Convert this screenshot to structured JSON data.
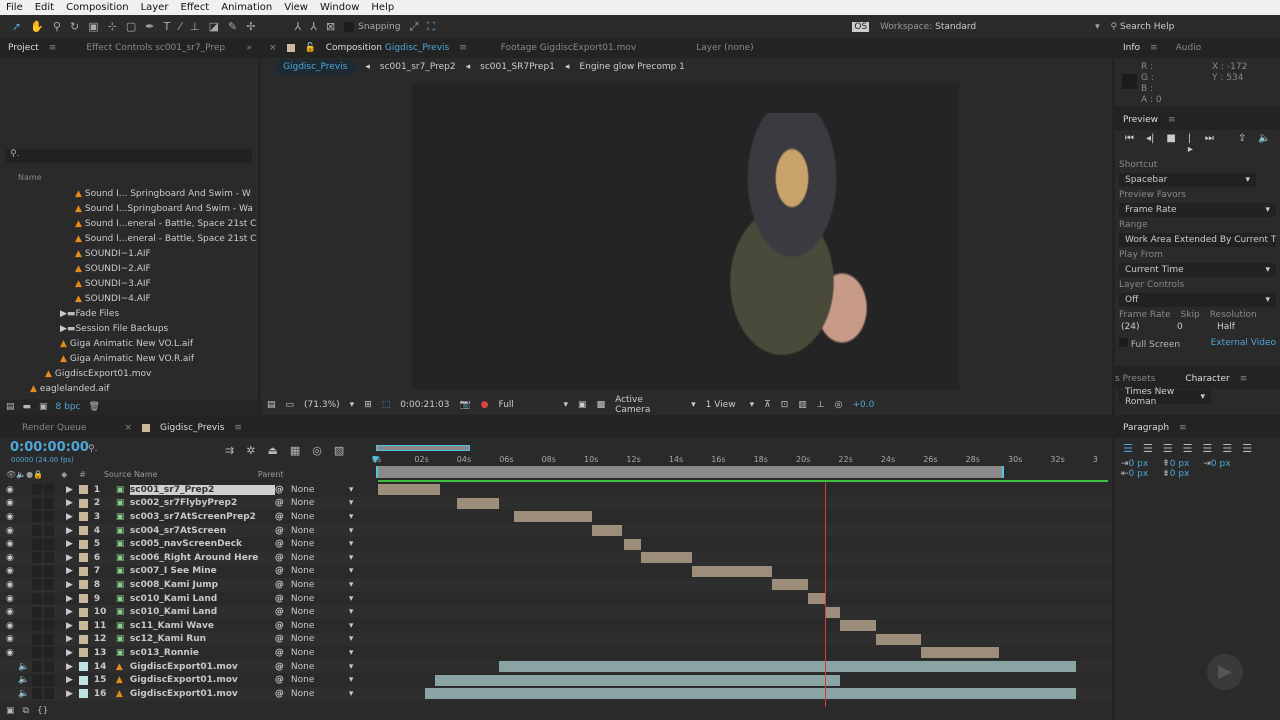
{
  "menu": [
    "File",
    "Edit",
    "Composition",
    "Layer",
    "Effect",
    "Animation",
    "View",
    "Window",
    "Help"
  ],
  "toolbar": {
    "snapping": "Snapping",
    "workspace_label": "Workspace:",
    "workspace": "Standard",
    "search": "Search Help"
  },
  "project": {
    "tab": "Project",
    "effect_tab": "Effect Controls sc001_sr7_Prep",
    "name_col": "Name",
    "bpc": "8 bpc",
    "items": [
      {
        "name": "Sound I... Springboard And Swim - W",
        "type": "audio",
        "indent": 3
      },
      {
        "name": "Sound I...Springboard And Swim - Wa",
        "type": "audio",
        "indent": 3
      },
      {
        "name": "Sound I...eneral - Battle, Space 21st C",
        "type": "audio",
        "indent": 3
      },
      {
        "name": "Sound I...eneral - Battle, Space 21st C",
        "type": "audio",
        "indent": 3
      },
      {
        "name": "SOUNDI~1.AIF",
        "type": "audio",
        "indent": 3
      },
      {
        "name": "SOUNDI~2.AIF",
        "type": "audio",
        "indent": 3
      },
      {
        "name": "SOUNDI~3.AIF",
        "type": "audio",
        "indent": 3
      },
      {
        "name": "SOUNDI~4.AIF",
        "type": "audio",
        "indent": 3
      },
      {
        "name": "Fade Files",
        "type": "folder",
        "indent": 2
      },
      {
        "name": "Session File Backups",
        "type": "folder",
        "indent": 2
      },
      {
        "name": "Giga Animatic New VO.L.aif",
        "type": "audio",
        "indent": 2
      },
      {
        "name": "Giga Animatic New VO.R.aif",
        "type": "audio",
        "indent": 2
      },
      {
        "name": "GigdiscExport01.mov",
        "type": "audio",
        "indent": 1
      },
      {
        "name": "eaglelanded.aif",
        "type": "audio",
        "indent": 0
      }
    ]
  },
  "viewer": {
    "comp_tab": "Composition",
    "comp_name": "Gigdisc_Previs",
    "footage_tab": "Footage GigdiscExport01.mov",
    "layer_tab": "Layer (none)",
    "breadcrumbs": [
      "Gigdisc_Previs",
      "sc001_sr7_Prep2",
      "sc001_SR7Prep1",
      "Engine glow Precomp 1"
    ],
    "zoom": "(71.3%)",
    "timecode": "0:00:21:03",
    "resolution": "Full",
    "camera": "Active Camera",
    "views": "1 View",
    "exposure": "+0.0"
  },
  "info": {
    "tab": "Info",
    "audio_tab": "Audio",
    "r": "R :",
    "g": "G :",
    "b": "B :",
    "a": "A : 0",
    "x": "X : -172",
    "y": "Y : 534"
  },
  "preview": {
    "title": "Preview",
    "shortcut_label": "Shortcut",
    "shortcut": "Spacebar",
    "favors_label": "Preview Favors",
    "favors": "Frame Rate",
    "range_label": "Range",
    "range": "Work Area Extended By Current Ti",
    "play_from_label": "Play From",
    "play_from": "Current Time",
    "layer_controls_label": "Layer Controls",
    "layer_controls": "Off",
    "frame_rate_label": "Frame Rate",
    "skip_label": "Skip",
    "resolution_label": "Resolution",
    "frame_rate": "(24)",
    "skip": "0",
    "resolution": "Half",
    "full_screen": "Full Screen",
    "external_video": "External Video"
  },
  "character": {
    "presets_tab": "s Presets",
    "tab": "Character",
    "font": "Times New Roman"
  },
  "paragraph": {
    "tab": "Paragraph",
    "values": [
      "0 px",
      "0 px",
      "0 px",
      "0 px",
      "0 px"
    ]
  },
  "timeline": {
    "render_queue_tab": "Render Queue",
    "comp_tab": "Gigdisc_Previs",
    "timecode": "0:00:00:00",
    "frames": "00000 (24.00 fps)",
    "col_num": "#",
    "col_source": "Source Name",
    "col_parent": "Parent",
    "ticks": [
      "0s",
      "02s",
      "04s",
      "06s",
      "08s",
      "10s",
      "12s",
      "14s",
      "16s",
      "18s",
      "20s",
      "22s",
      "24s",
      "26s",
      "28s",
      "30s",
      "32s",
      "3"
    ],
    "current_time_s": 21.2,
    "work_area_end_s": 29.5,
    "layers": [
      {
        "n": "1",
        "name": "sc001_sr7_Prep2",
        "parent": "None",
        "kind": "comp",
        "in": 0.1,
        "out": 3.0
      },
      {
        "n": "2",
        "name": "sc002_sr7FlybyPrep2",
        "parent": "None",
        "kind": "comp",
        "in": 3.8,
        "out": 5.8
      },
      {
        "n": "3",
        "name": "sc003_sr7AtScreenPrep2",
        "parent": "None",
        "kind": "comp",
        "in": 6.5,
        "out": 10.2
      },
      {
        "n": "4",
        "name": "sc004_sr7AtScreen",
        "parent": "None",
        "kind": "comp",
        "in": 10.2,
        "out": 11.6
      },
      {
        "n": "5",
        "name": "sc005_navScreenDeck",
        "parent": "None",
        "kind": "comp",
        "in": 11.7,
        "out": 12.5
      },
      {
        "n": "6",
        "name": "sc006_Right Around Here",
        "parent": "None",
        "kind": "comp",
        "in": 12.5,
        "out": 14.9
      },
      {
        "n": "7",
        "name": "sc007_I See Mine",
        "parent": "None",
        "kind": "comp",
        "in": 14.9,
        "out": 18.7
      },
      {
        "n": "8",
        "name": "sc008_Kami Jump",
        "parent": "None",
        "kind": "comp",
        "in": 18.7,
        "out": 20.4
      },
      {
        "n": "9",
        "name": "sc010_Kami Land",
        "parent": "None",
        "kind": "comp",
        "in": 20.4,
        "out": 21.2
      },
      {
        "n": "10",
        "name": "sc010_Kami Land",
        "parent": "None",
        "kind": "comp",
        "in": 21.2,
        "out": 21.9
      },
      {
        "n": "11",
        "name": "sc11_Kami Wave",
        "parent": "None",
        "kind": "comp",
        "in": 21.9,
        "out": 23.6
      },
      {
        "n": "12",
        "name": "sc12_Kami Run",
        "parent": "None",
        "kind": "comp",
        "in": 23.6,
        "out": 25.7
      },
      {
        "n": "13",
        "name": "sc013_Ronnie",
        "parent": "None",
        "kind": "comp",
        "in": 25.7,
        "out": 29.4
      },
      {
        "n": "14",
        "name": "GigdiscExport01.mov",
        "parent": "None",
        "kind": "audio",
        "in": 5.8,
        "out": 33
      },
      {
        "n": "15",
        "name": "GigdiscExport01.mov",
        "parent": "None",
        "kind": "audio",
        "in": 2.8,
        "out": 21.9
      },
      {
        "n": "16",
        "name": "GigdiscExport01.mov",
        "parent": "None",
        "kind": "audio",
        "in": 2.3,
        "out": 33
      }
    ]
  },
  "colors": {
    "accent": "#4fa6d8",
    "comp_label": "#c8b99a",
    "audio_label": "#bfe3e0",
    "playhead": "#d33c3c",
    "work_area": "#3fbf3f"
  }
}
